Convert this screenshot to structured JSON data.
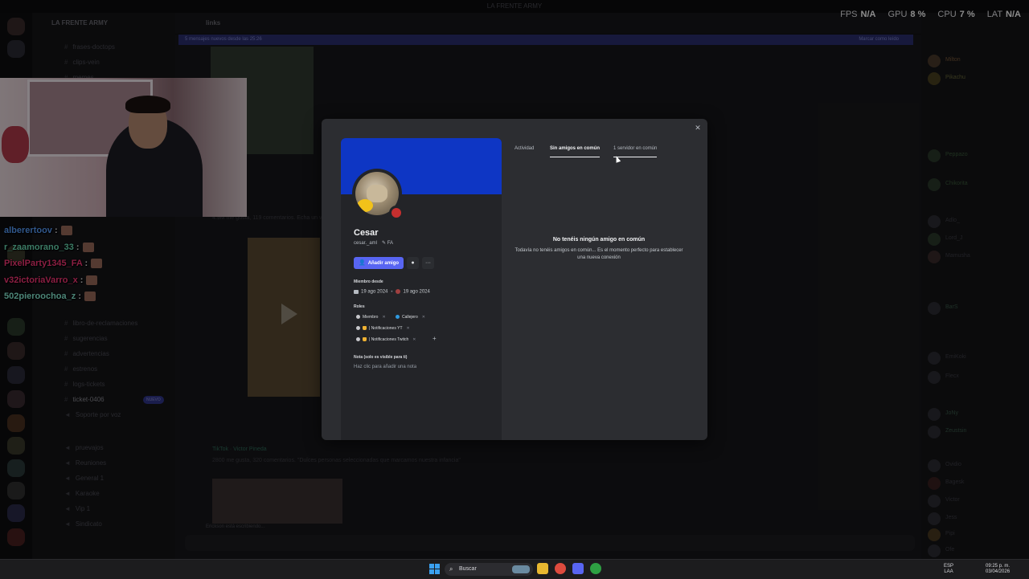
{
  "app": {
    "window_title": "LA FRENTE ARMY"
  },
  "hud": {
    "fps_label": "FPS",
    "fps_value": "N/A",
    "gpu_label": "GPU",
    "gpu_value": "8 %",
    "cpu_label": "CPU",
    "cpu_value": "7 %",
    "lat_label": "LAT",
    "lat_value": "N/A"
  },
  "server": {
    "name": "LA FRENTE ARMY",
    "channels": [
      "frases-doctops",
      "clips-vein",
      "memes",
      "libro-de-reclamaciones",
      "sugerencias",
      "advertencias",
      "estrenos",
      "logs-tickets",
      "ticket-0406",
      "Soporte por voz",
      "pruevajos",
      "Reuniones",
      "General 1",
      "Karaoke",
      "Vip 1",
      "Sindicato"
    ],
    "new_badge": "NUEVO"
  },
  "chat": {
    "channel": "links",
    "unread_banner": "5 mensajes nuevos desde las 25:26",
    "mark_read": "Marcar como leído",
    "typing": "Erickson está escribiendo...",
    "snippets": [
      "4.9M me gusta, 119 comentarios. Echa un vistazo al video de Vadim Galdón",
      "TikTok · Victor Pineda",
      "2800 me gusta, 320 comentarios. \"Dulces personas seleccionadas que marcamos nuestra infancia\""
    ]
  },
  "stream_chat": [
    {
      "user": "alberertoov",
      "color": "#5aa0ff"
    },
    {
      "user": "r_zaamorano_33",
      "color": "#6de0b8"
    },
    {
      "user": "PixelParty1345_FA",
      "color": "#ff3a7a"
    },
    {
      "user": "v32ictoriaVarro_x",
      "color": "#ff3a7a"
    },
    {
      "user": "502pieroochoa_z",
      "color": "#8af0d8"
    }
  ],
  "members": {
    "names": [
      "Milton",
      "Pikachu",
      "Peppazo",
      "Chikorita",
      "Adlo_",
      "Lord_J",
      "Mamusha",
      "BarS",
      "EmiKoki",
      "Flecx",
      "JoNy",
      "Zeustsin",
      "Ovidio",
      "Bagesk",
      "Victor",
      "Jess",
      "Pipi",
      "Ofe"
    ]
  },
  "profile": {
    "display_name": "Cesar",
    "username": "cesar._aml",
    "server_tag": "FA",
    "add_friend_label": "Añadir amigo",
    "message_icon": "message-icon",
    "more_icon": "more-icon",
    "member_since_label": "Miembro desde",
    "discord_date": "19 ago 2024",
    "server_date": "19 ago 2024",
    "roles_label": "Roles",
    "roles": [
      {
        "name": "Miembro",
        "color": "#c8c8cc"
      },
      {
        "name": "Callejero",
        "color": "#2f9ae0"
      },
      {
        "name": "| Notificaciones YT",
        "color": "#c8c8cc"
      },
      {
        "name": "| Notificaciones Twitch",
        "color": "#c8c8cc"
      }
    ],
    "note_label": "Nota (solo es visible para ti)",
    "note_placeholder": "Haz clic para añadir una nota",
    "banner_color": "#0e36c4"
  },
  "tabs": [
    {
      "label": "Actividad",
      "active": false
    },
    {
      "label": "Sin amigos en común",
      "active": true
    },
    {
      "label": "1 servidor en común",
      "active": false
    }
  ],
  "empty_state": {
    "title": "No tenéis ningún amigo en común",
    "subtitle": "Todavía no tenéis amigos en común... Es el momento perfecto para establecer una nueva conexión"
  },
  "taskbar": {
    "search_placeholder": "Buscar",
    "lang": "ESP",
    "lang_sub": "LAA",
    "time": "09:25 p. m.",
    "date": "03/04/2026"
  }
}
